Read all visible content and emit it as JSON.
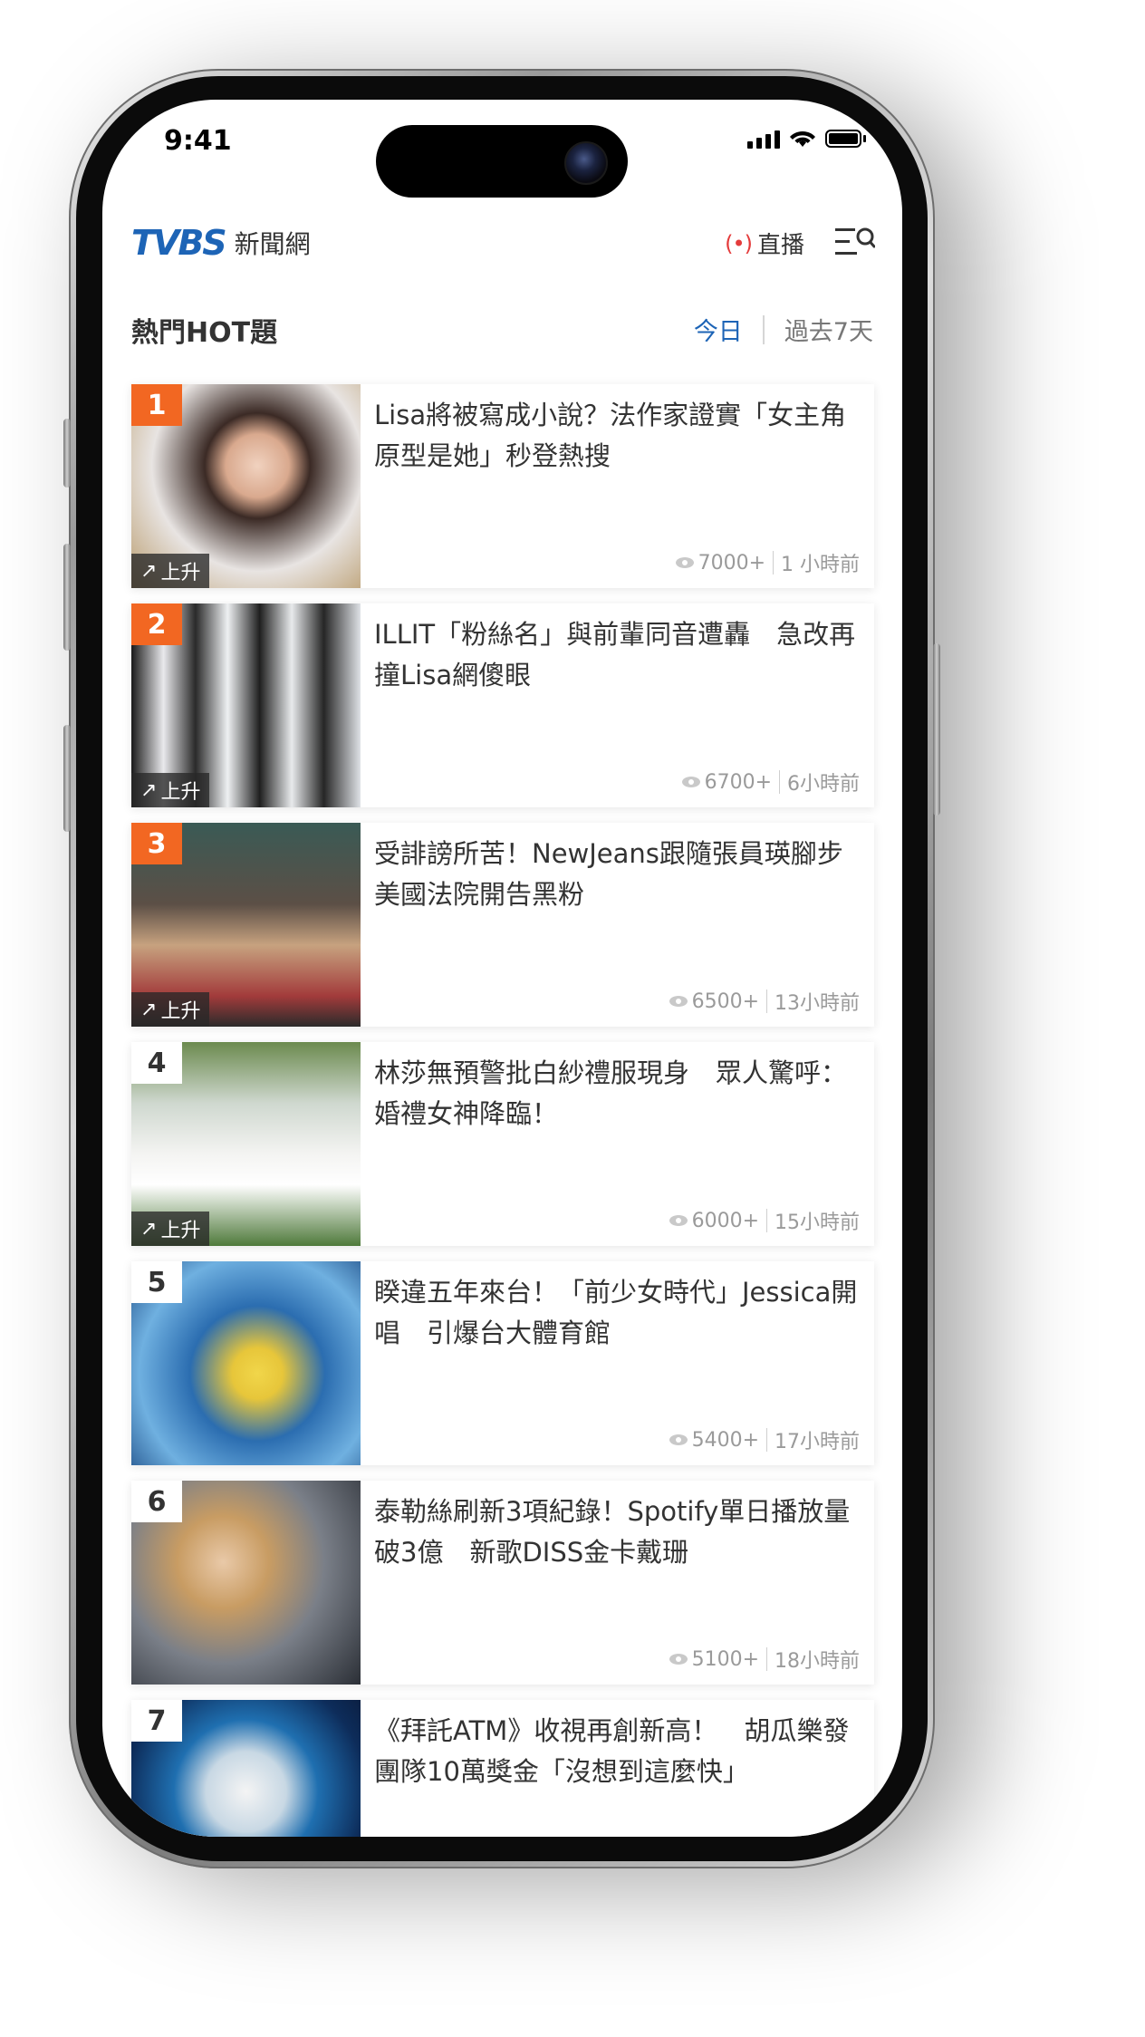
{
  "status_bar": {
    "time": "9:41"
  },
  "header": {
    "logo_mark": "TVBS",
    "logo_text": "新聞網",
    "live_indicator": "(•)",
    "live_label": "直播",
    "menu_search_icon": "menu-search-icon"
  },
  "section": {
    "title": "熱門HOT題",
    "tabs": [
      {
        "label": "今日",
        "active": true
      },
      {
        "label": "過去7天",
        "active": false
      }
    ]
  },
  "colors": {
    "brand_blue": "#1d64b6",
    "rank_hot": "#f26722",
    "live_red": "#e43b3b",
    "text_main": "#333333",
    "text_muted": "#9a9a9a"
  },
  "items": [
    {
      "rank": "1",
      "hot": true,
      "trend": "上升",
      "title": "Lisa將被寫成小說？法作家證實「女主角原型是她」秒登熱搜",
      "views": "7000+",
      "time": "1 小時前"
    },
    {
      "rank": "2",
      "hot": true,
      "trend": "上升",
      "title": "ILLIT「粉絲名」與前輩同音遭轟　急改再撞Lisa網傻眼",
      "views": "6700+",
      "time": "6小時前"
    },
    {
      "rank": "3",
      "hot": true,
      "trend": "上升",
      "title": "受誹謗所苦！NewJeans跟隨張員瑛腳步　美國法院開告黑粉",
      "views": "6500+",
      "time": "13小時前"
    },
    {
      "rank": "4",
      "hot": false,
      "trend": "上升",
      "title": "林莎無預警批白紗禮服現身　眾人驚呼：婚禮女神降臨！",
      "views": "6000+",
      "time": "15小時前"
    },
    {
      "rank": "5",
      "hot": false,
      "trend": "",
      "title": "睽違五年來台！「前少女時代」Jessica開唱　引爆台大體育館",
      "views": "5400+",
      "time": "17小時前"
    },
    {
      "rank": "6",
      "hot": false,
      "trend": "",
      "title": "泰勒絲刷新3項紀錄！Spotify單日播放量破3億　新歌DISS金卡戴珊",
      "views": "5100+",
      "time": "18小時前"
    },
    {
      "rank": "7",
      "hot": false,
      "trend": "",
      "title": "《拜託ATM》收視再創新高！　胡瓜樂發團隊10萬獎金「沒想到這麼快」",
      "views": "",
      "time": ""
    }
  ]
}
